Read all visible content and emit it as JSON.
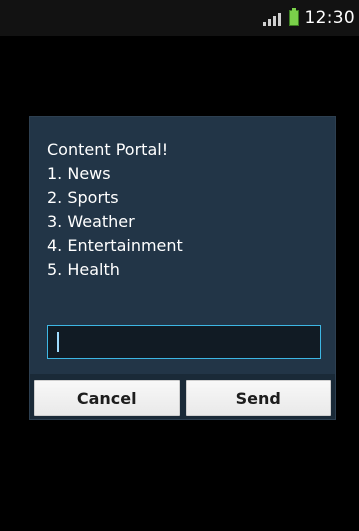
{
  "status_bar": {
    "time": "12:30",
    "colors": {
      "battery": "#7ad14a"
    }
  },
  "dialog": {
    "lines": [
      "Content Portal!",
      "1. News",
      "2. Sports",
      "3. Weather",
      "4. Entertainment",
      "5. Health"
    ],
    "input_value": "",
    "buttons": {
      "cancel": "Cancel",
      "send": "Send"
    },
    "colors": {
      "background": "#223547",
      "input_border": "#3db7e4"
    }
  }
}
